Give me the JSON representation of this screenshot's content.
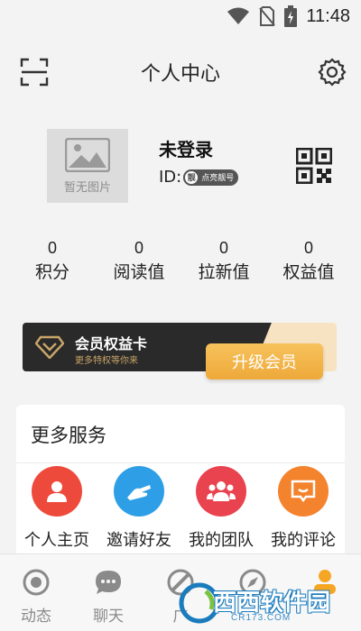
{
  "status_bar": {
    "time": "11:48",
    "icons": [
      "wifi-icon",
      "no-sim-icon",
      "battery-charging-icon"
    ]
  },
  "header": {
    "title": "个人中心",
    "left_icon": "scan-icon",
    "right_icon": "gear-icon"
  },
  "profile": {
    "avatar_placeholder": "暂无图片",
    "username": "未登录",
    "id_label": "ID:",
    "id_badge_char": "靓",
    "id_badge_text": "点亮靓号",
    "qr_icon": "qr-code-icon"
  },
  "stats": [
    {
      "value": "0",
      "label": "积分"
    },
    {
      "value": "0",
      "label": "阅读值"
    },
    {
      "value": "0",
      "label": "拉新值"
    },
    {
      "value": "0",
      "label": "权益值"
    }
  ],
  "vip_card": {
    "title": "会员权益卡",
    "subtitle": "更多特权等你来",
    "button": "升级会员",
    "icon": "diamond-icon"
  },
  "services": {
    "title": "更多服务",
    "items": [
      {
        "label": "个人主页",
        "icon": "person-icon",
        "color": "#ee4a3c"
      },
      {
        "label": "邀请好友",
        "icon": "handshake-icon",
        "color": "#2e9fe6"
      },
      {
        "label": "我的团队",
        "icon": "team-icon",
        "color": "#e9434f"
      },
      {
        "label": "我的评论",
        "icon": "comment-icon",
        "color": "#f4832e"
      }
    ]
  },
  "tabbar": {
    "items": [
      {
        "label": "动态",
        "icon": "disc-icon",
        "active": false
      },
      {
        "label": "聊天",
        "icon": "chat-bubble-icon",
        "active": false
      },
      {
        "label": "广",
        "icon": "slash-circle-icon",
        "active": false
      },
      {
        "label": "",
        "icon": "compass-icon",
        "active": false
      },
      {
        "label": "",
        "icon": "user-tab-icon",
        "active": true
      }
    ],
    "active_color": "#f5a623"
  },
  "watermark": {
    "main": "西西软件园",
    "url": "CR173.COM"
  }
}
